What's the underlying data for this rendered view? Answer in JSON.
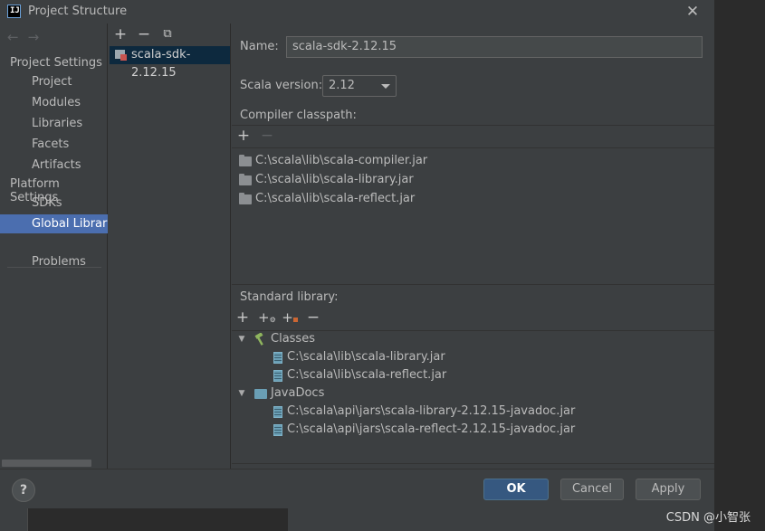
{
  "window": {
    "title": "Project Structure"
  },
  "nav": {
    "project_settings_header": "Project Settings",
    "project_items": [
      "Project",
      "Modules",
      "Libraries",
      "Facets",
      "Artifacts"
    ],
    "platform_settings_header": "Platform Settings",
    "platform_items": [
      "SDKs",
      "Global Libraries"
    ],
    "other_items": [
      "Problems"
    ],
    "selected": "Global Libraries"
  },
  "sdk_list": {
    "items": [
      "scala-sdk-2.12.15"
    ]
  },
  "detail": {
    "name_label": "Name:",
    "name_value": "scala-sdk-2.12.15",
    "scala_version_label": "Scala version:",
    "scala_version_value": "2.12",
    "compiler_classpath_label": "Compiler classpath:",
    "compiler_classpath": [
      "C:\\scala\\lib\\scala-compiler.jar",
      "C:\\scala\\lib\\scala-library.jar",
      "C:\\scala\\lib\\scala-reflect.jar"
    ],
    "standard_library_label": "Standard library:",
    "classes_label": "Classes",
    "classes": [
      "C:\\scala\\lib\\scala-library.jar",
      "C:\\scala\\lib\\scala-reflect.jar"
    ],
    "javadocs_label": "JavaDocs",
    "javadocs": [
      "C:\\scala\\api\\jars\\scala-library-2.12.15-javadoc.jar",
      "C:\\scala\\api\\jars\\scala-reflect-2.12.15-javadoc.jar"
    ]
  },
  "footer": {
    "help": "?",
    "ok": "OK",
    "cancel": "Cancel",
    "apply": "Apply"
  },
  "watermark": "CSDN @小智张",
  "colors": {
    "selection": "#4b6eaf",
    "dialog_bg": "#3c3f41",
    "ok_button": "#365880"
  }
}
